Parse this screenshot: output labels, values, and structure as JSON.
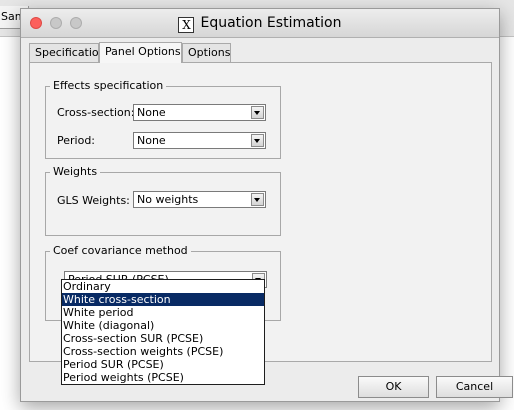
{
  "background": {
    "tab_label": "Sampl"
  },
  "dialog": {
    "title": "Equation Estimation",
    "title_icon_glyph": "X",
    "tabs": [
      {
        "label": "Specification"
      },
      {
        "label": "Panel Options"
      },
      {
        "label": "Options"
      }
    ]
  },
  "effects": {
    "legend": "Effects specification",
    "cross_section_label": "Cross-section:",
    "cross_section_value": "None",
    "period_label": "Period:",
    "period_value": "None"
  },
  "weights": {
    "legend": "Weights",
    "gls_label": "GLS Weights:",
    "gls_value": "No weights"
  },
  "coef": {
    "legend": "Coef covariance method",
    "value": "Period SUR (PCSE)",
    "options": [
      "Ordinary",
      "White cross-section",
      "White period",
      "White (diagonal)",
      "Cross-section SUR (PCSE)",
      "Cross-section weights (PCSE)",
      "Period SUR (PCSE)",
      "Period weights (PCSE)"
    ],
    "highlighted": "White cross-section"
  },
  "buttons": {
    "ok": "OK",
    "cancel": "Cancel"
  },
  "colors": {
    "selection": "#082a64",
    "close_light": "#fc605c"
  },
  "icons": {
    "close": "close-traffic-light-icon",
    "minimize": "minimize-traffic-light-icon",
    "maximize": "maximize-traffic-light-icon",
    "app": "eviews-app-icon",
    "dropdown": "chevron-down-icon"
  }
}
